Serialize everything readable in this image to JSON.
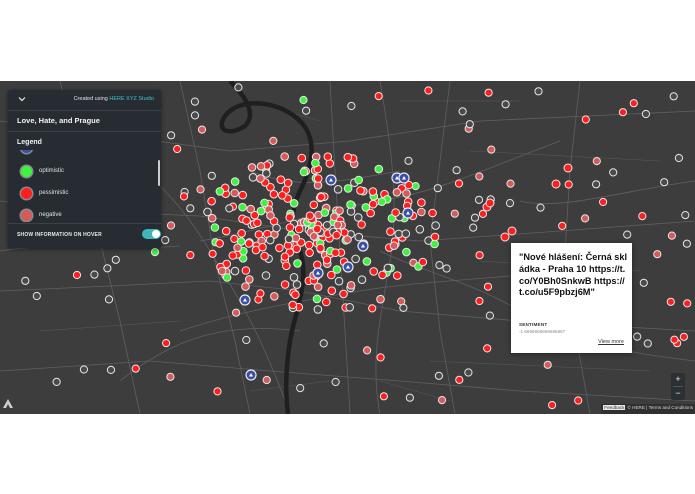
{
  "panel": {
    "credit_prefix": "Created using",
    "credit_brand": "HERE XYZ Studio",
    "title": "Love, Hate, and Prague",
    "legend_title": "Legend",
    "legend": [
      {
        "label": "optimistic",
        "color": "#3ff23f"
      },
      {
        "label": "pessimistic",
        "color": "#ff1e1e"
      },
      {
        "label": "negative",
        "color": "#d65a5a"
      }
    ],
    "hover_label": "SHOW INFORMATION ON HOVER",
    "hover_enabled": true
  },
  "popup": {
    "tweet": "\"Nové hlášení: Černá skládka - Praha 10 https://t.co/Y0Bh0SnkwB https://t.co/u5F9pbzj6M\"",
    "sentiment_label": "SENTIMENT",
    "sentiment_value": "-1.6666666666666667",
    "view_more": "View more"
  },
  "zoom": {
    "in": "+",
    "out": "−"
  },
  "attribution": {
    "feedback": "Feedback",
    "text": "© HERE | Terms and Conditions"
  },
  "map": {
    "background": "#3d3d3d",
    "road_color": "#6a6a6a",
    "river_color": "#1f1f1f",
    "marker_colors": {
      "green": "#3ff23f",
      "red": "#ff1e1e",
      "grey": "#4a4a4a",
      "salmon": "#d65a5a",
      "blue": "#3b4fa8"
    }
  }
}
